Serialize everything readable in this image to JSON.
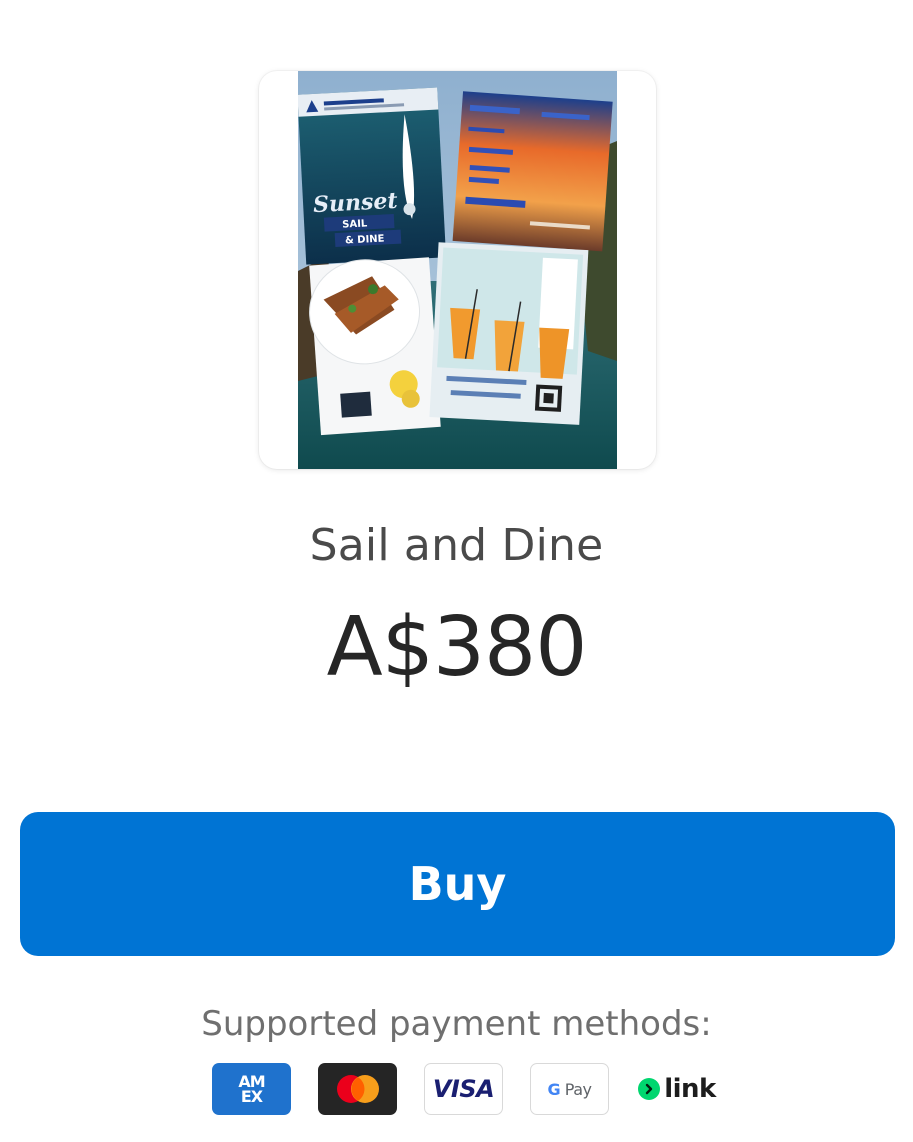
{
  "product": {
    "image": {
      "poster_text": "Sunset SAIL & DINE"
    },
    "name": "Sail and Dine",
    "price": "A$380"
  },
  "checkout": {
    "buy_label": "Buy"
  },
  "payment_methods": {
    "label": "Supported payment methods:",
    "methods": [
      {
        "name": "American Express",
        "icon": "amex-icon",
        "text_top": "AM",
        "text_bottom": "EX",
        "color": "#1f72cd"
      },
      {
        "name": "Mastercard",
        "icon": "mastercard-icon",
        "color": "#252525"
      },
      {
        "name": "Visa",
        "icon": "visa-icon",
        "text": "VISA",
        "color": "#1a1f71"
      },
      {
        "name": "Google Pay",
        "icon": "google-pay-icon",
        "text_g": "G",
        "text": "Pay",
        "color": "#5f6368"
      },
      {
        "name": "Link",
        "icon": "link-icon",
        "text": "link",
        "color": "#00d66f"
      }
    ]
  },
  "colors": {
    "button": "#0074d4",
    "button_text": "#ffffff",
    "name_text": "#4a4a4a",
    "price_text": "#262626",
    "label_text": "#6f6f6f"
  }
}
